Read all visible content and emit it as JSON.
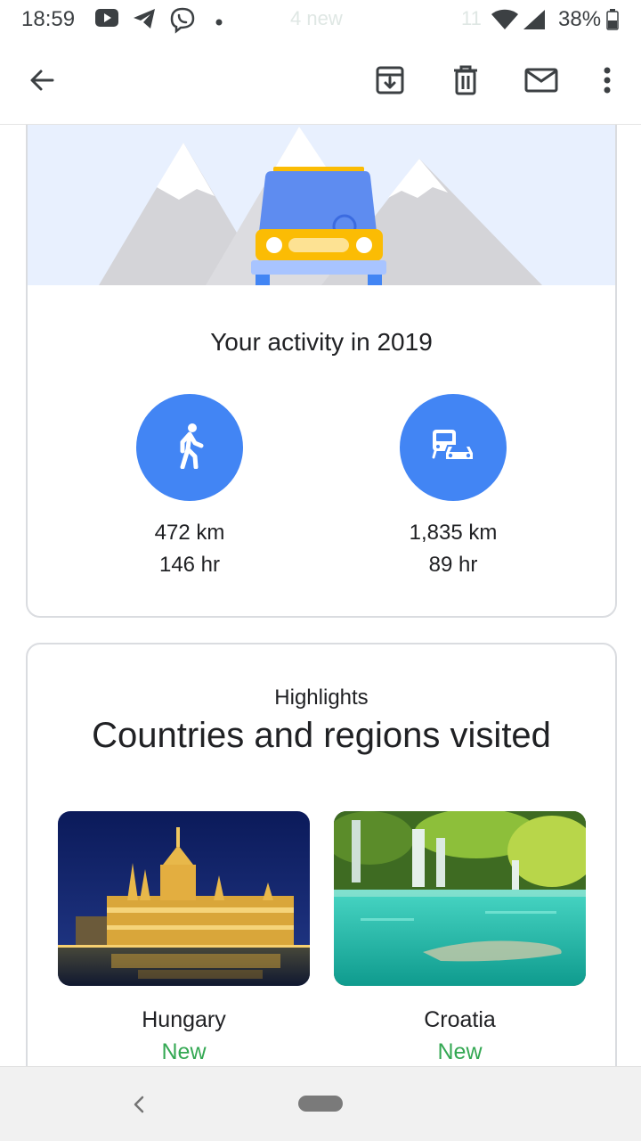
{
  "status_bar": {
    "time": "18:59",
    "ghost_notification": "4 new",
    "ghost_left": "11",
    "battery": "38%",
    "icons": [
      "youtube-icon",
      "telegram-icon",
      "viber-icon",
      "dot-icon",
      "wifi-icon",
      "signal-icon",
      "battery-icon"
    ]
  },
  "app_bar": {
    "icons": [
      "back-arrow-icon",
      "archive-icon",
      "delete-icon",
      "mark-unread-icon",
      "more-vert-icon"
    ]
  },
  "activity": {
    "title": "Your activity in 2019",
    "stats": [
      {
        "icon": "walking-icon",
        "distance": "472 km",
        "duration": "146 hr"
      },
      {
        "icon": "driving-transit-icon",
        "distance": "1,835 km",
        "duration": "89 hr"
      }
    ]
  },
  "highlights": {
    "eyebrow": "Highlights",
    "title": "Countries and regions visited",
    "places": [
      {
        "name": "Hungary",
        "badge": "New",
        "image": "budapest-parliament-at-night"
      },
      {
        "name": "Croatia",
        "badge": "New",
        "image": "plitvice-lakes-waterfall"
      }
    ]
  },
  "colors": {
    "accent_blue": "#4285f4",
    "new_green": "#34a853",
    "hero_bg": "#e8f0fe",
    "car_yellow": "#fbbc04"
  },
  "nav_bar": {
    "icons": [
      "nav-back-icon",
      "nav-home-pill"
    ]
  }
}
